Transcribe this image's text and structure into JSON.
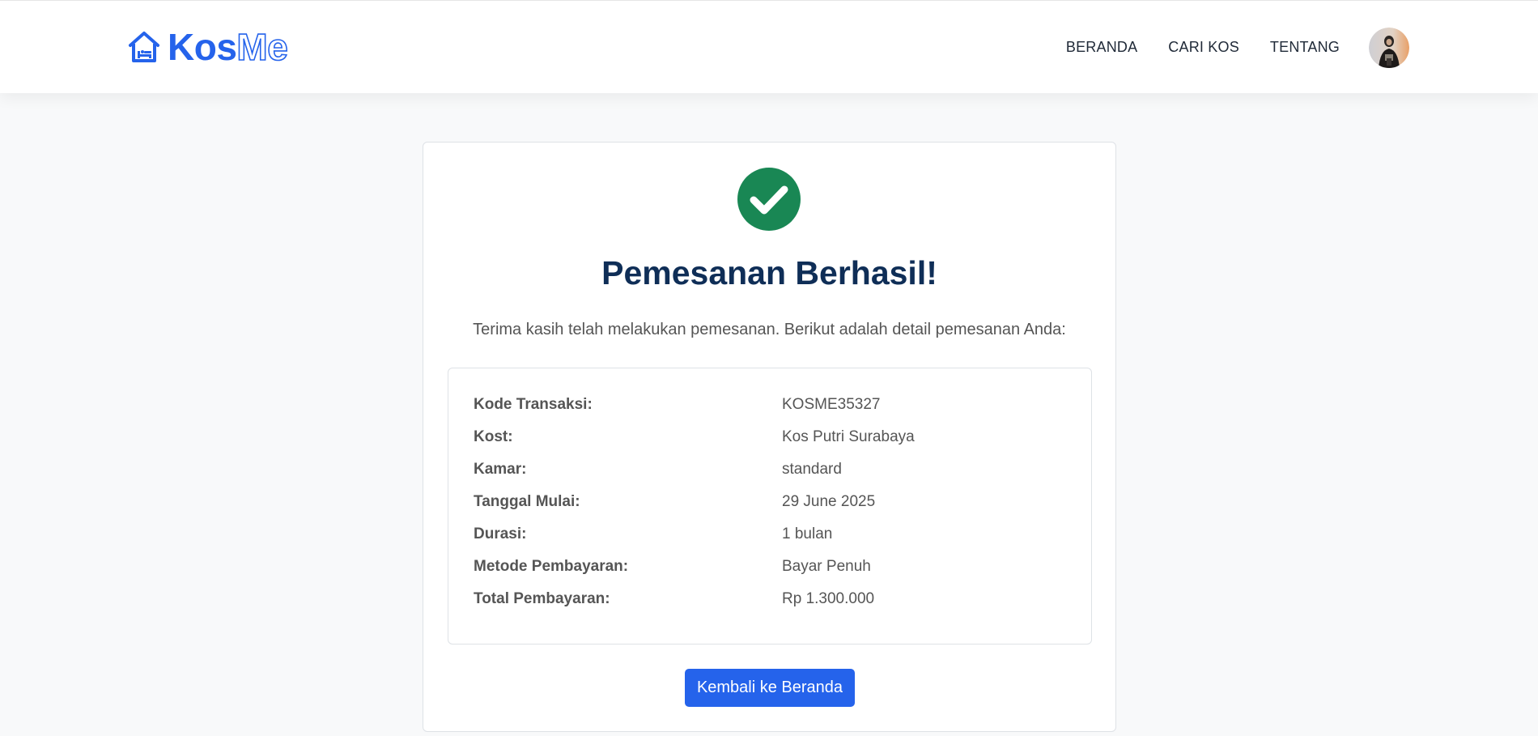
{
  "navbar": {
    "brand_part1": "Kos",
    "brand_part2": "Me",
    "links": [
      "BERANDA",
      "CARI KOS",
      "TENTANG"
    ]
  },
  "confirmation": {
    "title": "Pemesanan Berhasil!",
    "message": "Terima kasih telah melakukan pemesanan. Berikut adalah detail pemesanan Anda:",
    "details": [
      {
        "label": "Kode Transaksi:",
        "value": "KOSME35327"
      },
      {
        "label": "Kost:",
        "value": "Kos Putri Surabaya"
      },
      {
        "label": "Kamar:",
        "value": "standard"
      },
      {
        "label": "Tanggal Mulai:",
        "value": "29 June 2025"
      },
      {
        "label": "Durasi:",
        "value": "1 bulan"
      },
      {
        "label": "Metode Pembayaran:",
        "value": "Bayar Penuh"
      },
      {
        "label": "Total Pembayaran:",
        "value": "Rp 1.300.000"
      }
    ],
    "back_button": "Kembali ke Beranda"
  },
  "colors": {
    "brand": "#2563eb",
    "success": "#198754",
    "title": "#0f2e57"
  },
  "icons": {
    "logo": "house-bed-icon",
    "success": "check-circle-icon",
    "avatar": "user-avatar"
  }
}
